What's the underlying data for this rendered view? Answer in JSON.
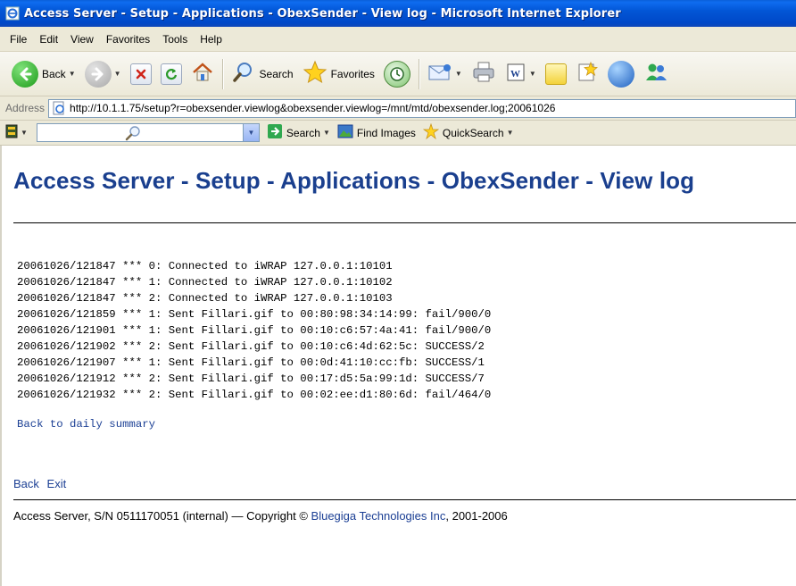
{
  "window": {
    "title": "Access Server - Setup - Applications - ObexSender - View log - Microsoft Internet Explorer"
  },
  "menu": [
    "File",
    "Edit",
    "View",
    "Favorites",
    "Tools",
    "Help"
  ],
  "toolbar": {
    "back_label": "Back",
    "search_label": "Search",
    "favorites_label": "Favorites"
  },
  "address": {
    "label": "Address",
    "url": "http://10.1.1.75/setup?r=obexsender.viewlog&obexsender.viewlog=/mnt/mtd/obexsender.log;20061026"
  },
  "linksbar": {
    "search_placeholder": "",
    "search_label": "Search",
    "find_images_label": "Find Images",
    "quicksearch_label": "QuickSearch"
  },
  "page": {
    "heading": "Access Server - Setup - Applications - ObexSender - View log",
    "log_lines": [
      "20061026/121847 *** 0: Connected to iWRAP 127.0.0.1:10101",
      "20061026/121847 *** 1: Connected to iWRAP 127.0.0.1:10102",
      "20061026/121847 *** 2: Connected to iWRAP 127.0.0.1:10103",
      "20061026/121859 *** 1: Sent Fillari.gif to 00:80:98:34:14:99: fail/900/0",
      "20061026/121901 *** 1: Sent Fillari.gif to 00:10:c6:57:4a:41: fail/900/0",
      "20061026/121902 *** 2: Sent Fillari.gif to 00:10:c6:4d:62:5c: SUCCESS/2",
      "20061026/121907 *** 1: Sent Fillari.gif to 00:0d:41:10:cc:fb: SUCCESS/1",
      "20061026/121912 *** 2: Sent Fillari.gif to 00:17:d5:5a:99:1d: SUCCESS/7",
      "20061026/121932 *** 2: Sent Fillari.gif to 00:02:ee:d1:80:6d: fail/464/0"
    ],
    "back_to_summary": "Back to daily summary",
    "back_link": "Back",
    "exit_link": "Exit",
    "footer_prefix": "Access Server, S/N 0511170051 (internal)  —  Copyright © ",
    "footer_company": "Bluegiga Technologies Inc",
    "footer_suffix": ", 2001-2006"
  },
  "colors": {
    "heading": "#1a3f8e",
    "link": "#1b3f94",
    "titlebar": "#0256d6"
  }
}
